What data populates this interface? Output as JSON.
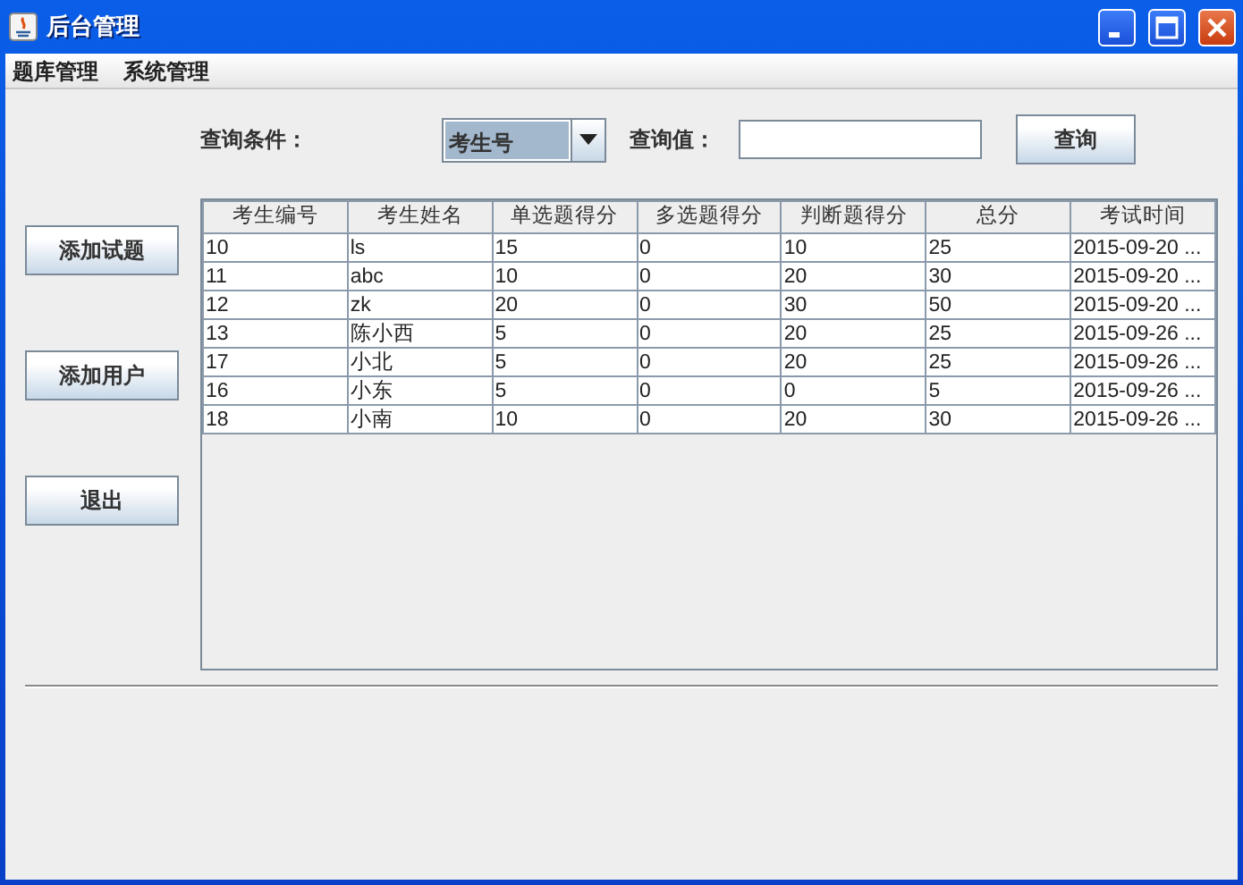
{
  "window": {
    "title": "后台管理"
  },
  "menu": [
    "题库管理",
    "系统管理"
  ],
  "query": {
    "condition_label": "查询条件：",
    "condition_value": "考生号",
    "value_label": "查询值：",
    "button": "查询"
  },
  "side_buttons": [
    "添加试题",
    "添加用户",
    "退出"
  ],
  "table": {
    "columns": [
      "考生编号",
      "考生姓名",
      "单选题得分",
      "多选题得分",
      "判断题得分",
      "总分",
      "考试时间"
    ],
    "rows": [
      [
        "10",
        "ls",
        "15",
        "0",
        "10",
        "25",
        "2015-09-20 ..."
      ],
      [
        "11",
        "abc",
        "10",
        "0",
        "20",
        "30",
        "2015-09-20 ..."
      ],
      [
        "12",
        "zk",
        "20",
        "0",
        "30",
        "50",
        "2015-09-20 ..."
      ],
      [
        "13",
        "陈小西",
        "5",
        "0",
        "20",
        "25",
        "2015-09-26 ..."
      ],
      [
        "17",
        "小北",
        "5",
        "0",
        "20",
        "25",
        "2015-09-26 ..."
      ],
      [
        "16",
        "小东",
        "5",
        "0",
        "0",
        "5",
        "2015-09-26 ..."
      ],
      [
        "18",
        "小南",
        "10",
        "0",
        "20",
        "30",
        "2015-09-26 ..."
      ]
    ]
  }
}
